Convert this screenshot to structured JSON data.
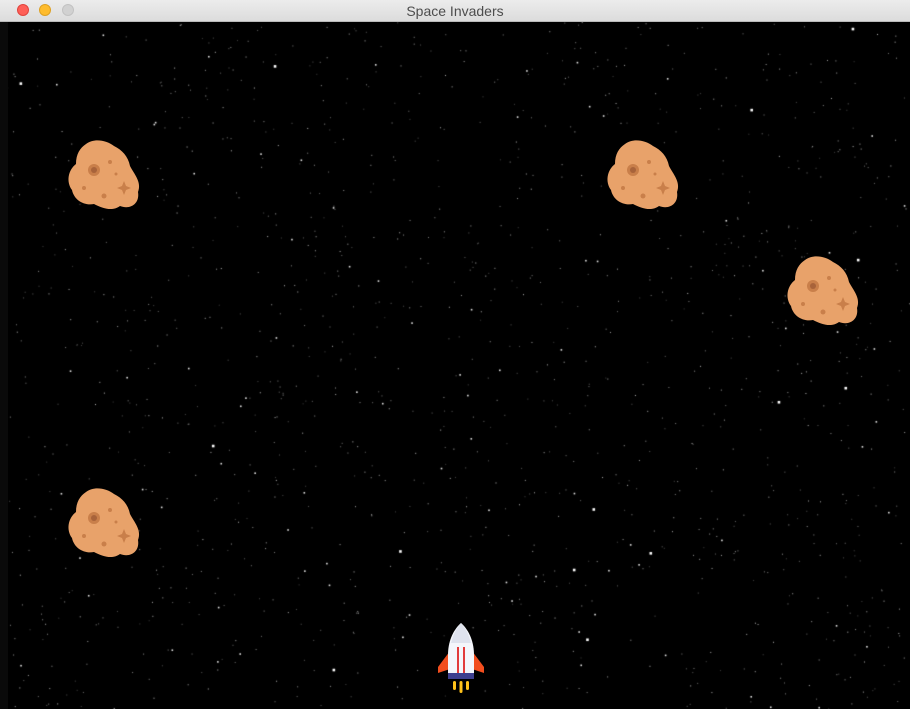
{
  "window": {
    "title": "Space Invaders"
  },
  "game": {
    "enemies": [
      {
        "type": "asteroid-enemy"
      },
      {
        "type": "asteroid-enemy"
      },
      {
        "type": "asteroid-enemy"
      },
      {
        "type": "asteroid-enemy"
      }
    ],
    "player": {
      "type": "rocket-ship"
    }
  },
  "colors": {
    "background": "#000000",
    "asteroid": "#e8a26a",
    "asteroid_shade": "#c97f4a",
    "rocket_body": "#f4f6fb",
    "rocket_stripe": "#e23c3c",
    "rocket_fins": "#f24e1e",
    "rocket_base": "#3d3f8f",
    "rocket_flame": "#ffc21a"
  }
}
